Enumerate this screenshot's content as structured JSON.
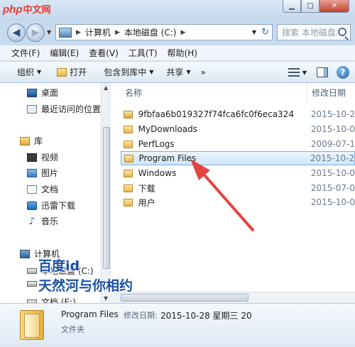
{
  "branding": {
    "logo_php": "php",
    "logo_cn": "中文网"
  },
  "window": {
    "minimize_glyph": "▁",
    "maximize_glyph": "□",
    "close_glyph": "✕"
  },
  "address": {
    "back_glyph": "◀",
    "forward_glyph": "▶",
    "breadcrumbs": [
      "计算机",
      "本地磁盘 (C:)"
    ],
    "separator": "▶",
    "dropdown_glyph": "▼",
    "refresh_glyph": "↻"
  },
  "search": {
    "placeholder": "搜索 本地磁盘..."
  },
  "menu": [
    "文件(F)",
    "编辑(E)",
    "查看(V)",
    "工具(T)",
    "帮助(H)"
  ],
  "toolbar": {
    "organize": "组织",
    "open": "打开",
    "include_in_library": "包含到库中",
    "share": "共享",
    "more": "»",
    "help_glyph": "?"
  },
  "nav": [
    {
      "label": "桌面",
      "icon": "desktop-icon"
    },
    {
      "label": "最近访问的位置",
      "icon": "recent-places-icon"
    },
    {
      "label": "库",
      "icon": "library-icon"
    },
    {
      "label": "视频",
      "icon": "video-icon"
    },
    {
      "label": "图片",
      "icon": "pictures-icon"
    },
    {
      "label": "文档",
      "icon": "documents-icon"
    },
    {
      "label": "迅雷下载",
      "icon": "thunder-download-icon"
    },
    {
      "label": "音乐",
      "icon": "music-icon"
    },
    {
      "label": "计算机",
      "icon": "computer-icon"
    },
    {
      "label": "本地磁盘 (C:)",
      "icon": "drive-icon"
    },
    {
      "label": "",
      "icon": "drive-icon"
    },
    {
      "label": "文档 (E:)",
      "icon": "drive-icon"
    }
  ],
  "columns": {
    "name": "名称",
    "date": "修改日期"
  },
  "files": [
    {
      "name": "9fbfaa6b019327f74fca6fc0f6eca324",
      "date": "2015-10-2",
      "locked": true
    },
    {
      "name": "MyDownloads",
      "date": "2015-10-0"
    },
    {
      "name": "PerfLogs",
      "date": "2009-07-1"
    },
    {
      "name": "Program Files",
      "date": "2015-10-2",
      "selected": true
    },
    {
      "name": "Windows",
      "date": "2015-10-0"
    },
    {
      "name": "下载",
      "date": "2015-07-0"
    },
    {
      "name": "用户",
      "date": "2015-10-0"
    }
  ],
  "details": {
    "name": "Program Files",
    "label": "修改日期:",
    "value": "2015-10-28 星期三 20",
    "type": "文件夹"
  },
  "watermark": {
    "line1": "百度id",
    "line2": "天然河与你相约"
  },
  "colors": {
    "annotation_arrow": "#e2453f",
    "selection": "#cfe6fb"
  }
}
